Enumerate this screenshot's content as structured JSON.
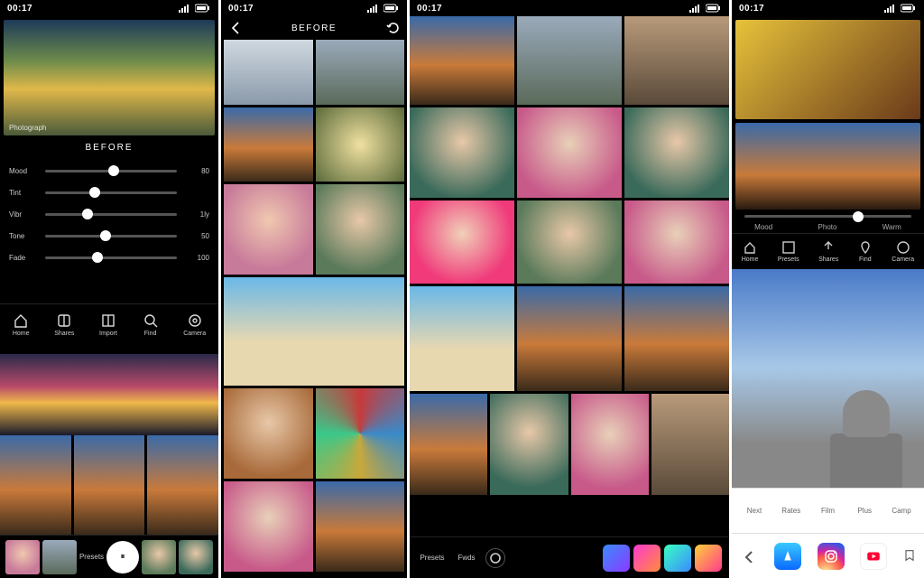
{
  "status": {
    "time": "00:17",
    "signal_icon": "signal-icon",
    "battery_icon": "battery-icon"
  },
  "phone1": {
    "hero_caption": "Photograph",
    "mode_label": "BEFORE",
    "sliders": [
      {
        "label": "Mood",
        "value": "80",
        "pos": 52
      },
      {
        "label": "Tint",
        "value": "",
        "pos": 38
      },
      {
        "label": "Vibr",
        "value": "1ly",
        "pos": 32
      },
      {
        "label": "Tone",
        "value": "50",
        "pos": 46
      },
      {
        "label": "Fade",
        "value": "100",
        "pos": 40
      }
    ],
    "nav": [
      {
        "label": "Home",
        "icon": "home-icon"
      },
      {
        "label": "Shares",
        "icon": "book-icon"
      },
      {
        "label": "Import",
        "icon": "layers-icon"
      },
      {
        "label": "Find",
        "icon": "search-icon"
      },
      {
        "label": "Camera",
        "icon": "camera-icon"
      }
    ],
    "strip_label": "Presets"
  },
  "phone2": {
    "title": "BEFORE",
    "back_icon": "chevron-left-icon",
    "action_icon": "refresh-icon"
  },
  "phone3": {
    "bottom_labels": [
      "Presets",
      "Fwds"
    ],
    "round_icon": "tune-icon"
  },
  "phone4": {
    "slider": {
      "pos": 68,
      "label_center": "Photo"
    },
    "small_labels": [
      "Mood",
      "Warm"
    ],
    "nav": [
      {
        "label": "Home",
        "icon": "home-icon"
      },
      {
        "label": "Presets",
        "icon": "grid-icon"
      },
      {
        "label": "Shares",
        "icon": "share-icon"
      },
      {
        "label": "Find",
        "icon": "pin-icon"
      },
      {
        "label": "Camera",
        "icon": "camera-icon"
      }
    ],
    "lowbar_labels": [
      "Next",
      "Rates",
      "Film",
      "Plus",
      "Camp"
    ],
    "apps": [
      "appstore",
      "instagram",
      "youtube"
    ]
  }
}
